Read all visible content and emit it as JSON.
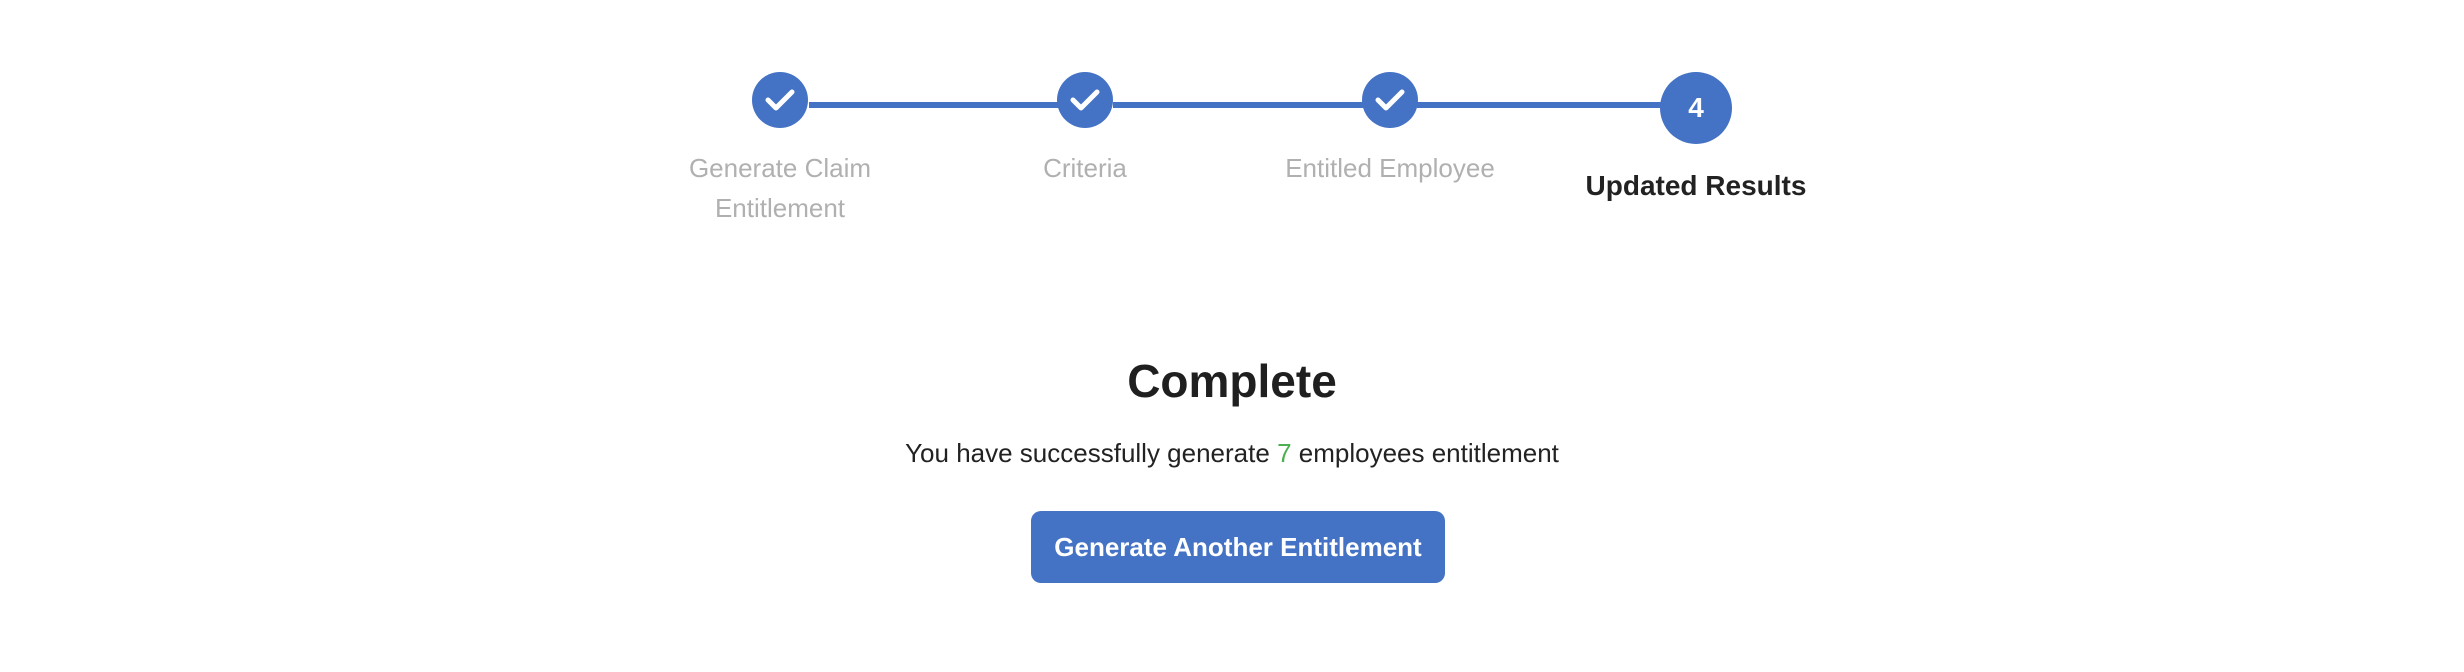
{
  "stepper": {
    "steps": [
      {
        "label": "Generate Claim Entitlement",
        "status": "completed",
        "icon": "check-icon"
      },
      {
        "label": "Criteria",
        "status": "completed",
        "icon": "check-icon"
      },
      {
        "label": "Entitled Employee",
        "status": "completed",
        "icon": "check-icon"
      },
      {
        "label": "Updated Results",
        "status": "current",
        "number": "4"
      }
    ]
  },
  "result": {
    "title": "Complete",
    "message_prefix": "You have successfully generate",
    "count": "7",
    "message_suffix": "employees entitlement"
  },
  "actions": {
    "generate_another_label": "Generate Another Entitlement"
  },
  "colors": {
    "accent": "#4472c4",
    "success": "#4caf50",
    "muted_text": "#b0b0b0",
    "text": "#222222"
  }
}
